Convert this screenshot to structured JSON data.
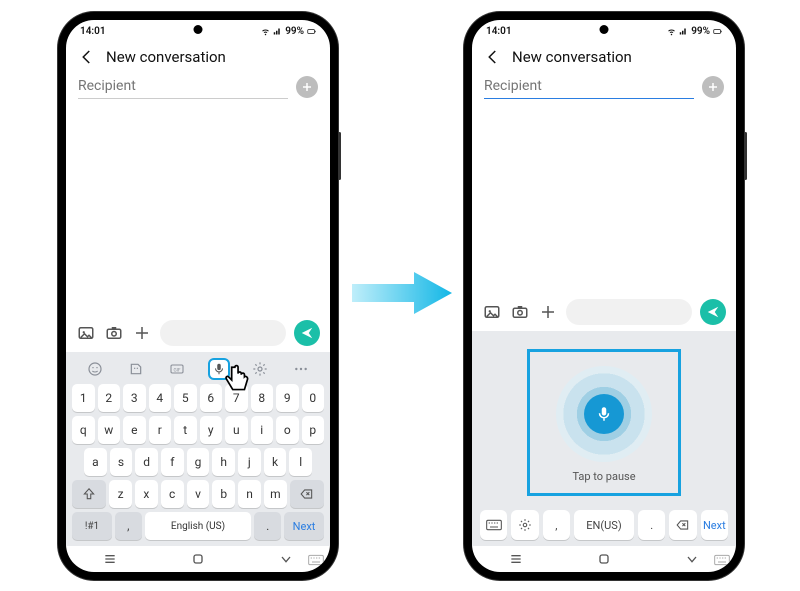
{
  "status": {
    "time": "14:01",
    "battery": "99%"
  },
  "header": {
    "title": "New conversation"
  },
  "recipient": {
    "placeholder": "Recipient"
  },
  "keyboard": {
    "numbers": [
      "1",
      "2",
      "3",
      "4",
      "5",
      "6",
      "7",
      "8",
      "9",
      "0"
    ],
    "row1": [
      "q",
      "w",
      "e",
      "r",
      "t",
      "y",
      "u",
      "i",
      "o",
      "p"
    ],
    "row2": [
      "a",
      "s",
      "d",
      "f",
      "g",
      "h",
      "j",
      "k",
      "l"
    ],
    "row3": [
      "z",
      "x",
      "c",
      "v",
      "b",
      "n",
      "m"
    ],
    "sym": "!#1",
    "comma": ",",
    "lang": "English (US)",
    "period": ".",
    "next": "Next",
    "toolbar": [
      "emoji",
      "sticker",
      "gif",
      "mic",
      "settings",
      "more"
    ]
  },
  "voice": {
    "tap_label": "Tap to pause",
    "lang": "EN(US)",
    "comma": ",",
    "period": ".",
    "next": "Next",
    "row_icons": [
      "keyboard",
      "settings",
      "comma",
      "lang",
      "period",
      "backspace",
      "next"
    ]
  },
  "colors": {
    "accent": "#1bbfa8",
    "highlight": "#17a2e0",
    "mic": "#1698d4"
  }
}
